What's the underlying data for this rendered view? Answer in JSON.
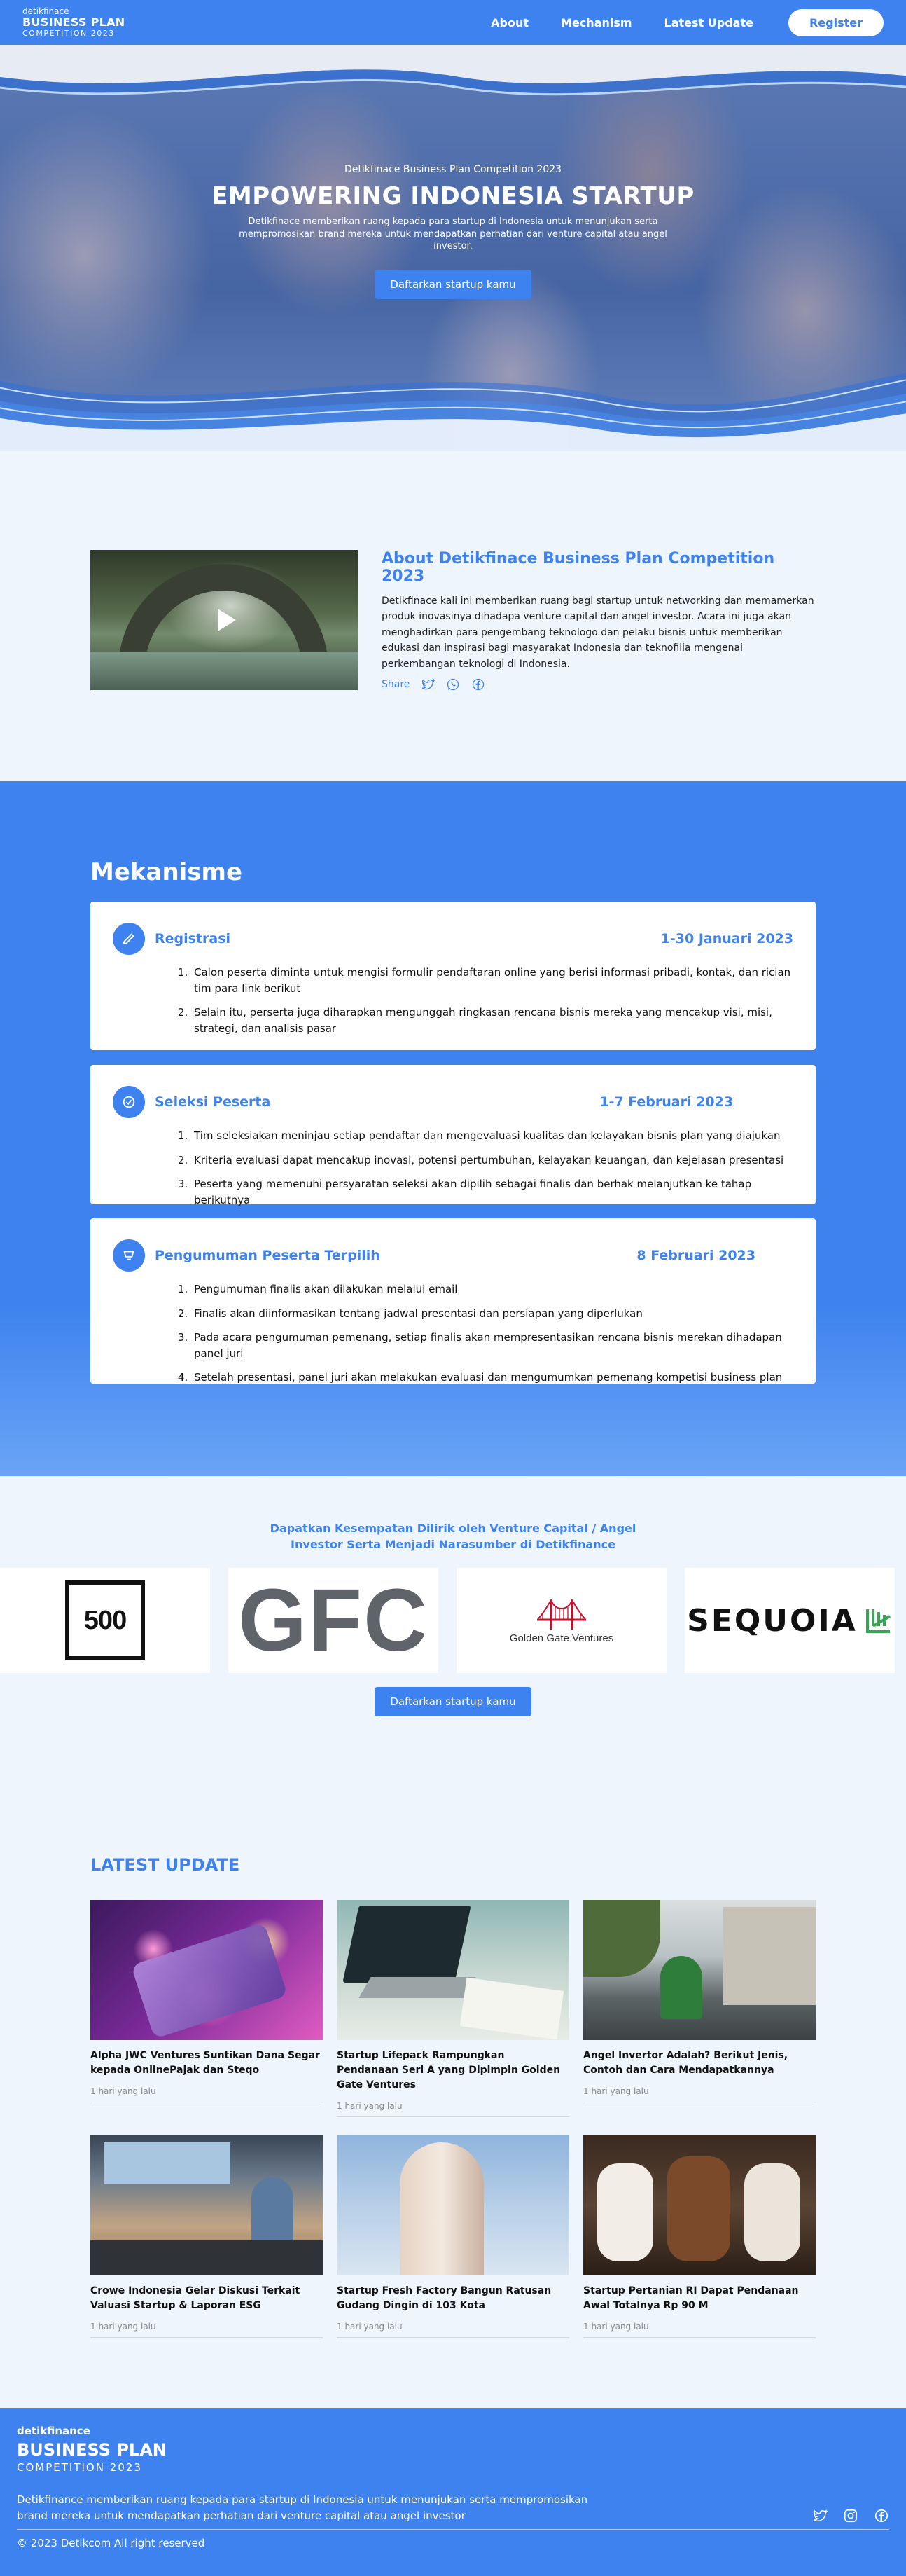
{
  "nav": {
    "brand_small": "detikfinace",
    "brand_big": "BUSINESS PLAN",
    "brand_comp": "COMPETITION 2023",
    "links": [
      "About",
      "Mechanism",
      "Latest Update"
    ],
    "register": "Register"
  },
  "hero": {
    "subtitle": "Detikfinace Business Plan Competition 2023",
    "title": "EMPOWERING INDONESIA STARTUP",
    "description": "Detikfinace memberikan ruang kepada para startup di Indonesia untuk menunjukan serta mempromosikan brand mereka untuk mendapatkan perhatian dari venture capital atau angel investor.",
    "cta": "Daftarkan startup kamu"
  },
  "about": {
    "title": "About Detikfinace Business Plan Competition 2023",
    "body": "Detikfinace kali ini memberikan ruang bagi startup untuk networking dan memamerkan produk inovasinya dihadapa venture capital dan angel investor. Acara ini juga akan menghadirkan para pengembang teknologo dan pelaku bisnis untuk memberikan edukasi dan inspirasi bagi masyarakat Indonesia dan teknofilia mengenai perkembangan teknologi di Indonesia.",
    "share_label": "Share",
    "share_icons": [
      "twitter-icon",
      "whatsapp-icon",
      "facebook-icon"
    ]
  },
  "mekanisme": {
    "title": "Mekanisme",
    "cards": [
      {
        "title": "Registrasi",
        "date": "1-30 Januari 2023",
        "icon": "pencil-icon",
        "items": [
          "Calon peserta diminta untuk mengisi formulir pendaftaran online yang berisi informasi pribadi, kontak, dan rician tim para link berikut",
          "Selain itu, perserta juga diharapkan mengunggah ringkasan rencana bisnis mereka yang mencakup visi, misi, strategi, dan analisis pasar"
        ]
      },
      {
        "title": "Seleksi Peserta",
        "date": "1-7 Februari 2023",
        "icon": "check-badge-icon",
        "items": [
          "Tim seleksiakan meninjau setiap pendaftar dan mengevaluasi kualitas dan kelayakan bisnis plan yang diajukan",
          "Kriteria evaluasi dapat mencakup inovasi, potensi pertumbuhan, kelayakan keuangan, dan kejelasan presentasi",
          "Peserta yang memenuhi persyaratan seleksi akan dipilih sebagai finalis dan berhak melanjutkan ke tahap berikutnya"
        ]
      },
      {
        "title": "Pengumuman Peserta Terpilih",
        "date": "8 Februari 2023",
        "icon": "announcement-icon",
        "items": [
          "Pengumuman finalis akan dilakukan melalui email",
          "Finalis akan diinformasikan tentang jadwal presentasi dan persiapan yang diperlukan",
          "Pada acara pengumuman pemenang, setiap finalis akan mempresentasikan rencana bisnis merekan dihadapan panel juri",
          "Setelah presentasi, panel juri akan melakukan evaluasi dan mengumumkan pemenang kompetisi business plan"
        ]
      }
    ]
  },
  "vc": {
    "title_line1": "Dapatkan Kesempatan Dilirik oleh Venture Capital / Angel",
    "title_line2": "Investor Serta Menjadi Narasumber di Detikfinance",
    "logos": {
      "l500": "500",
      "gfc": "GFC",
      "ggv": "Golden Gate Ventures",
      "sequoia": "SEQUOIA"
    },
    "cta": "Daftarkan startup kamu"
  },
  "latest": {
    "title": "LATEST UPDATE",
    "items": [
      {
        "title": "Alpha JWC Ventures Suntikan Dana Segar kepada OnlinePajak dan Steqo",
        "time": "1 hari yang lalu"
      },
      {
        "title": "Startup Lifepack Rampungkan Pendanaan Seri A yang Dipimpin Golden Gate Ventures",
        "time": "1 hari yang lalu"
      },
      {
        "title": "Angel Invertor Adalah? Berikut Jenis, Contoh dan Cara Mendapatkannya",
        "time": "1 hari yang lalu"
      },
      {
        "title": "Crowe Indonesia Gelar Diskusi Terkait Valuasi Startup & Laporan ESG",
        "time": "1 hari yang lalu"
      },
      {
        "title": "Startup Fresh Factory Bangun Ratusan Gudang Dingin di 103 Kota",
        "time": "1 hari yang lalu"
      },
      {
        "title": "Startup Pertanian RI Dapat Pendanaan Awal Totalnya Rp 90 M",
        "time": "1 hari yang lalu"
      }
    ]
  },
  "footer": {
    "brand_small": "detikfinance",
    "brand_big": "BUSINESS PLAN",
    "brand_comp": "COMPETITION 2023",
    "description": "Detikfinance memberikan ruang kepada para startup di Indonesia untuk menunjukan serta mempromosikan brand mereka untuk mendapatkan perhatian dari venture capital atau angel investor",
    "copyright": "© 2023 Detikcom All right reserved",
    "social_icons": [
      "twitter-icon",
      "instagram-icon",
      "facebook-icon"
    ]
  },
  "colors": {
    "primary": "#3d82ee",
    "background": "#eef5fd",
    "text": "#111111",
    "muted": "#8a8a8a"
  }
}
